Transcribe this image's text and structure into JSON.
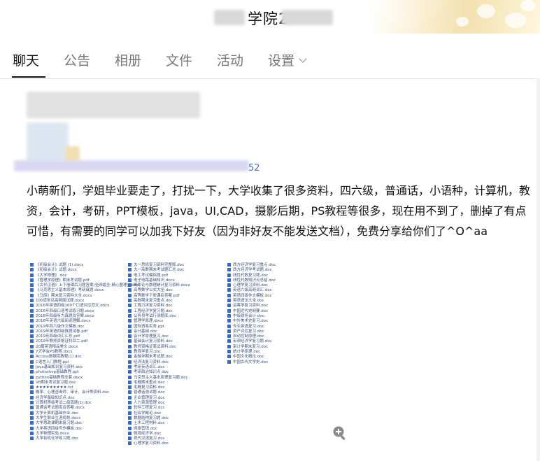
{
  "header": {
    "group_title": "学院2"
  },
  "tabs": [
    {
      "label": "聊天",
      "active": true
    },
    {
      "label": "公告",
      "active": false
    },
    {
      "label": "相册",
      "active": false
    },
    {
      "label": "文件",
      "active": false
    },
    {
      "label": "活动",
      "active": false
    },
    {
      "label": "设置",
      "active": false
    }
  ],
  "post": {
    "author_suffix": "52",
    "message": "小萌新们，学姐毕业要走了，打扰一下，大学收集了很多资料，四六级，普通话，小语种，计算机，教资，会计，考研，PPT模板，java，UI,CAD，摄影后期，PS教程等很多，现在用不到了，删掉了有点可惜，有需要的同学可以加我下好友（因为非好友不能发送文档），免费分享给你们了^O^aa",
    "zoom_icon": "zoom-in-icon",
    "file_columns": [
      [
        "《初级会计》试题 (1).docx",
        "《初级会计》试题.docx",
        "《大学物理》.doc",
        "《管理学原理》期末考试题.pdf",
        "《古代汉语》上下册课后习题答案(全网最全-精心整理).docx",
        "《马克思主义基本原理》考研真题.docx",
        "《马原》期末复习资料大全.docx",
        "100道常见高频面试题.docx",
        "2016年英语四级100个口语对应范文.docx",
        "2016年四级口语考试练习题.docx",
        "2018年四级听力真题及答案.docx",
        "2018年英语六级阅读理解.docx",
        "2019年四六级作文模板.doc",
        "2019年英语四级真题试卷.pdf",
        "2019年四级词汇汇总.pdf",
        "2019年教师资格证科目二.pdf",
        "20篇英语精品美文.docx",
        "7天学会PS教程.docx",
        "Access数据库教程(1).doc",
        "C语言入门教程.ppt",
        "Java基础知识复习资料.doc",
        "photoshop基础教程.ppt",
        "python基础教程全套.docx",
        "VB期末考试复习题.doc",
        "★★★★★★★★★.txt",
        "概率、心理咨询师、审计、会计等资料.doc",
        "经济学基础知识点.doc",
        "计算机等级考试二级真题(1).doc",
        "普通话考试题库及答案.docx",
        "大学计算机基础作业.doc",
        "大学生职业生涯规划.docx",
        "大学思政课期末复习题.doc",
        "大学英语四级写作模板.doc",
        "大学物理实验.docx",
        "大学有机化学练习题.doc"
      ],
      [
        "大一思修复习资料完整版.doc",
        "大一高数期末考试题汇总.doc",
        "电工考试模拟题.pdf",
        "电子电路基础知识.docx",
        "概率论与数理统计复习资料.docx",
        "高等数学公式大全.doc",
        "高等数学下册课后答案.pdf",
        "高数期末复习重点.doc",
        "工程力学复习资料.doc",
        "工程经济学复习题.doc",
        "公务员考试行测题库.doc",
        "管理学原理.docx",
        "国际贸易实务.ppt",
        "会计基础.doc",
        "会计学原理复习.doc",
        "基础会计复习资料.doc",
        "教师资格证笔试资料.doc",
        "教育学复习.doc",
        "金融学期末考试题.doc",
        "经济法复习资料.doc",
        "考研英语词汇.doc",
        "考研政治知识点.doc",
        "马克思主义基本原理复习题.doc",
        "毛概期末重点.doc",
        "毛概复习资料.doc",
        "普通话测试题.doc",
        "企业管理复习.doc",
        "人力资源管理.doc",
        "软件工程复习.doc",
        "社会学概论.doc",
        "数据结构复习题.doc",
        "土木工程材料.doc",
        "网络营销.doc",
        "微观经济学.doc",
        "现代汉语复习.doc",
        "心理学复习资料.doc"
      ],
      [
        "西方经济学复习重点.doc",
        "西方经济学考试题.doc",
        "线性代数复习题.doc",
        "线性代数知识点总结.doc",
        "心理学复习资料.doc",
        "英语六级高频词汇.doc",
        "英语四级作文模板.doc",
        "英语语法大全.doc",
        "运筹学复习资料.doc",
        "中国近代史纲要.doc",
        "中级财务会计.doc",
        "中外美术史复习.doc",
        "专业英语复习.doc",
        "资产评估复习.doc",
        "自动控制原理.doc",
        "宏观经济学复习题.doc",
        "审计学期末复习.doc",
        "统计学原理.doc",
        "中国文化概论.doc",
        "中国古代文学史.doc"
      ]
    ]
  }
}
